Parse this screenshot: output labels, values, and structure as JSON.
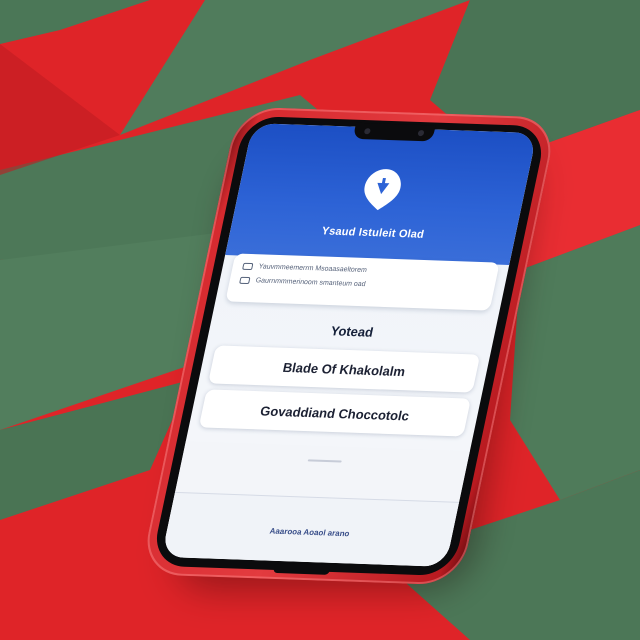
{
  "scene": {
    "colors": {
      "fabric_red": "#e32526",
      "fabric_green": "#4f7a5a",
      "phone_red": "#d62a2f",
      "header_blue": "#2d63d6"
    }
  },
  "app": {
    "header": {
      "icon": "shield-pin-icon",
      "title": "Ysaud Istuleit Olad"
    },
    "info_card": {
      "rows": [
        {
          "icon": "card-icon",
          "text": "Yauvmmeemerrm Msoaasaeltorem"
        },
        {
          "icon": "card-icon",
          "text": "Gaurnmmmerinoom smanteum oad"
        }
      ]
    },
    "section_title": "Yotead",
    "options": [
      {
        "label": "Blade Of Khakolalm"
      },
      {
        "label": "Govaddiand Choccotolc"
      }
    ],
    "bottom_link": "Aaarooa Aoaol arano"
  }
}
